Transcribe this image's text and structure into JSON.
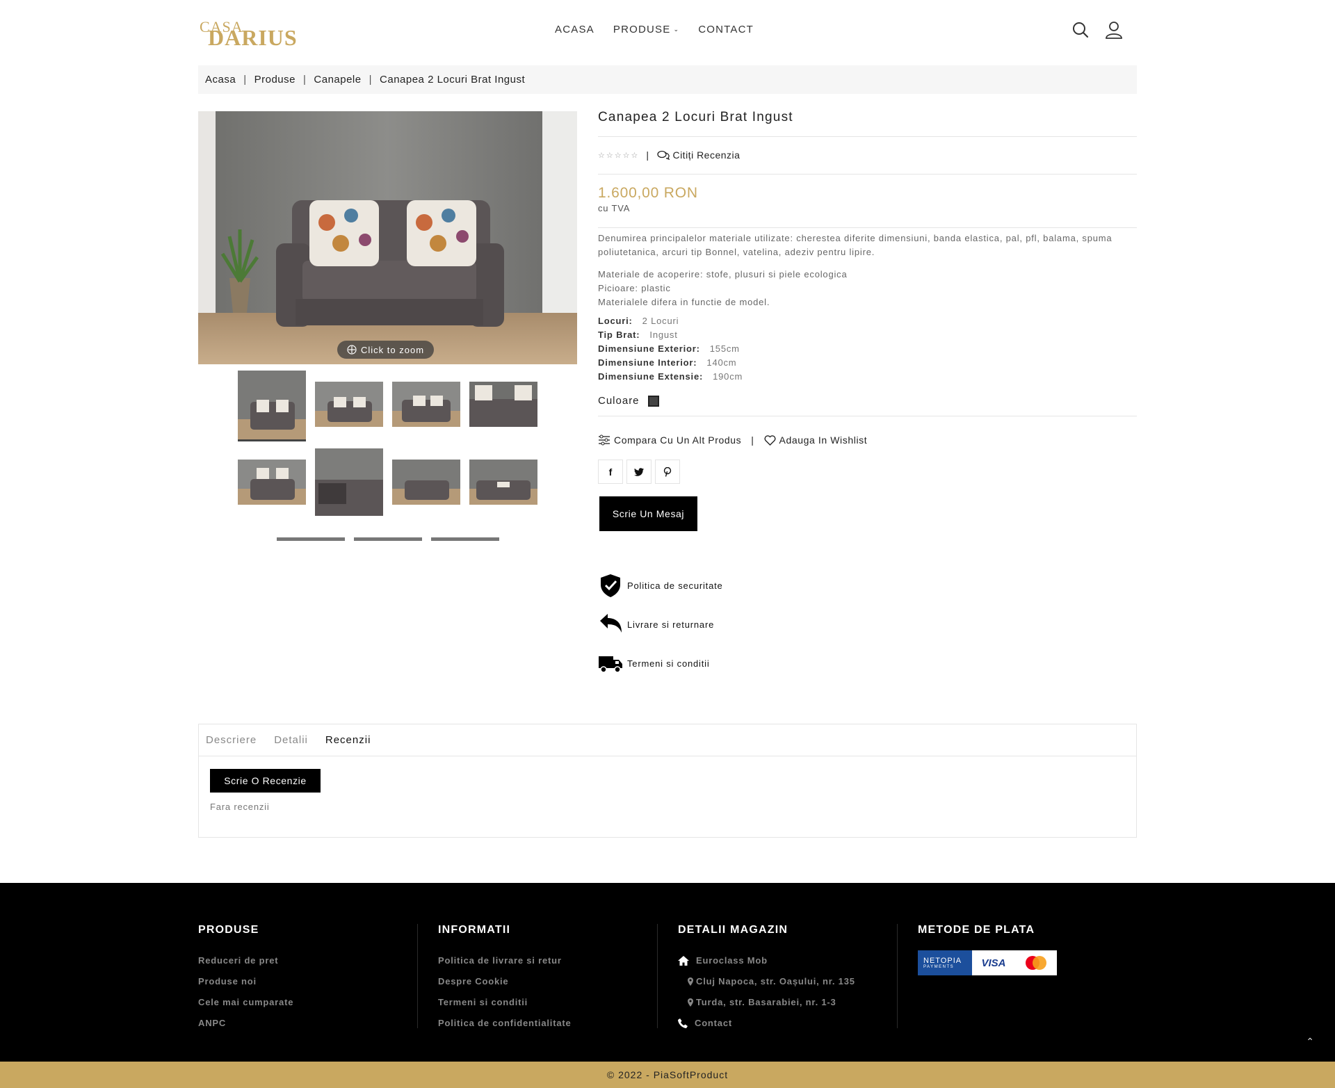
{
  "header": {
    "logo_top": "CASA",
    "logo_main": "DARIUS",
    "nav": [
      {
        "label": "ACASA"
      },
      {
        "label": "PRODUSE"
      },
      {
        "label": "CONTACT"
      }
    ]
  },
  "breadcrumb": [
    "Acasa",
    "Produse",
    "Canapele",
    "Canapea 2 Locuri Brat Ingust"
  ],
  "gallery": {
    "zoom_label": "Click to zoom"
  },
  "product": {
    "title": "Canapea 2 Locuri Brat Ingust",
    "reviews_link": "Citiți Recenzia",
    "rating": 0,
    "rating_max": 5,
    "price": "1.600,00 RON",
    "price_note": "cu TVA",
    "desc_1": "Denumirea principalelor materiale utilizate: cherestea diferite dimensiuni, banda elastica, pal, pfl, balama, spuma poliutetanica, arcuri tip Bonnel, vatelina, adeziv pentru lipire.",
    "desc_2": "Materiale de acoperire: stofe, plusuri si piele ecologica",
    "desc_3": "Picioare: plastic",
    "desc_4": "Materialele difera in functie de model.",
    "specs": [
      {
        "key": "Locuri:",
        "value": "2 Locuri"
      },
      {
        "key": "Tip Brat:",
        "value": "Ingust"
      },
      {
        "key": "Dimensiune Exterior:",
        "value": "155cm"
      },
      {
        "key": "Dimensiune Interior:",
        "value": "140cm"
      },
      {
        "key": "Dimensiune Extensie:",
        "value": "190cm"
      }
    ],
    "color_label": "Culoare",
    "color_swatch": "#444444",
    "compare_label": "Compara Cu Un Alt Produs",
    "wishlist_label": "Adauga In Wishlist",
    "message_button": "Scrie Un Mesaj"
  },
  "policies": [
    {
      "label": "Politica de securitate",
      "icon": "shield-check-icon"
    },
    {
      "label": "Livrare si returnare",
      "icon": "return-arrow-icon"
    },
    {
      "label": "Termeni si conditii",
      "icon": "truck-icon"
    }
  ],
  "tabs": {
    "items": [
      {
        "label": "Descriere"
      },
      {
        "label": "Detalii"
      },
      {
        "label": "Recenzii"
      }
    ],
    "active": "Recenzii",
    "review_button": "Scrie O Recenzie",
    "no_reviews": "Fara recenzii"
  },
  "footer": {
    "produse": {
      "title": "PRODUSE",
      "links": [
        "Reduceri de pret",
        "Produse noi",
        "Cele mai cumparate",
        "ANPC"
      ]
    },
    "informatii": {
      "title": "INFORMATII",
      "links": [
        "Politica de livrare si retur",
        "Despre Cookie",
        "Termeni si conditii",
        "Politica de confidentialitate"
      ]
    },
    "magazin": {
      "title": "DETALII MAGAZIN",
      "name": "Euroclass Mob",
      "address_1": "Cluj Napoca, str. Oașului, nr. 135",
      "address_2": "Turda, str. Basarabiei, nr. 1-3",
      "contact": "Contact"
    },
    "plata": {
      "title": "METODE DE PLATA",
      "netopia": "NETOPIA",
      "netopia_sub": "PAYMENTS",
      "visa": "VISA"
    },
    "copyright": "© 2022 - PiaSoftProduct"
  },
  "colors": {
    "accent_gold": "#c9a860",
    "footer_bg": "#000000"
  }
}
